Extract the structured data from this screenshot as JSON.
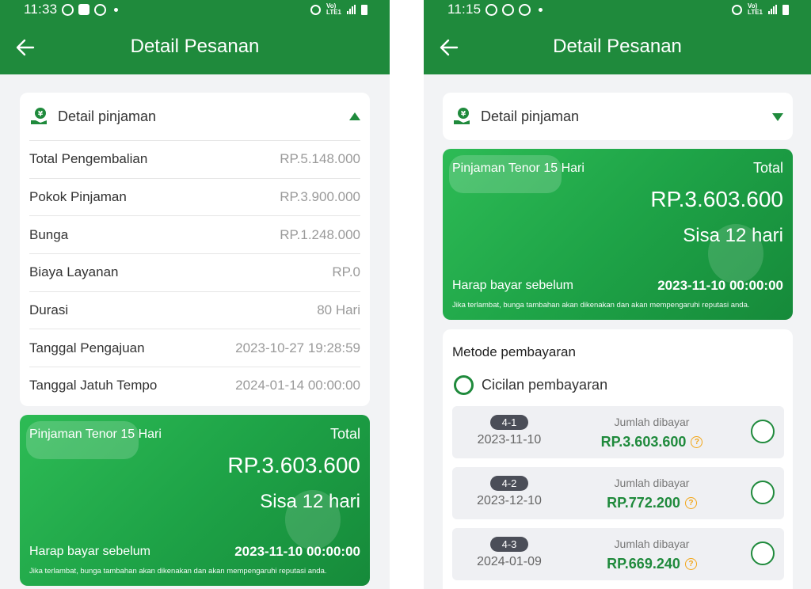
{
  "colors": {
    "brand_green": "#1f8a3c",
    "card_green": "#1ea347",
    "help_orange": "#f2a516"
  },
  "left_screen": {
    "status_time": "11:33",
    "title": "Detail Pesanan",
    "loan_section": {
      "title": "Detail pinjaman",
      "rows": [
        {
          "label": "Total Pengembalian",
          "value": "RP.5.148.000"
        },
        {
          "label": "Pokok Pinjaman",
          "value": "RP.3.900.000"
        },
        {
          "label": "Bunga",
          "value": "RP.1.248.000"
        },
        {
          "label": "Biaya Layanan",
          "value": "RP.0"
        },
        {
          "label": "Durasi",
          "value": "80 Hari"
        },
        {
          "label": "Tanggal Pengajuan",
          "value": "2023-10-27 19:28:59"
        },
        {
          "label": "Tanggal Jatuh Tempo",
          "value": "2024-01-14 00:00:00"
        }
      ]
    },
    "summary": {
      "tenor": "Pinjaman Tenor 15 Hari",
      "total_label": "Total",
      "amount": "RP.3.603.600",
      "remaining": "Sisa 12 hari",
      "pay_before_label": "Harap bayar sebelum",
      "deadline": "2023-11-10 00:00:00",
      "note": "Jika terlambat, bunga tambahan akan dikenakan dan akan mempengaruhi reputasi anda."
    }
  },
  "right_screen": {
    "status_time": "11:15",
    "title": "Detail Pesanan",
    "loan_section": {
      "title": "Detail pinjaman"
    },
    "summary": {
      "tenor": "Pinjaman Tenor 15 Hari",
      "total_label": "Total",
      "amount": "RP.3.603.600",
      "remaining": "Sisa 12 hari",
      "pay_before_label": "Harap bayar sebelum",
      "deadline": "2023-11-10 00:00:00",
      "note": "Jika terlambat, bunga tambahan akan dikenakan dan akan mempengaruhi reputasi anda."
    },
    "payment": {
      "title": "Metode pembayaran",
      "option_label": "Cicilan pembayaran",
      "installments": [
        {
          "badge": "4-1",
          "date": "2023-11-10",
          "amount_label": "Jumlah dibayar",
          "amount": "RP.3.603.600"
        },
        {
          "badge": "4-2",
          "date": "2023-12-10",
          "amount_label": "Jumlah dibayar",
          "amount": "RP.772.200"
        },
        {
          "badge": "4-3",
          "date": "2024-01-09",
          "amount_label": "Jumlah dibayar",
          "amount": "RP.669.240"
        }
      ]
    }
  }
}
